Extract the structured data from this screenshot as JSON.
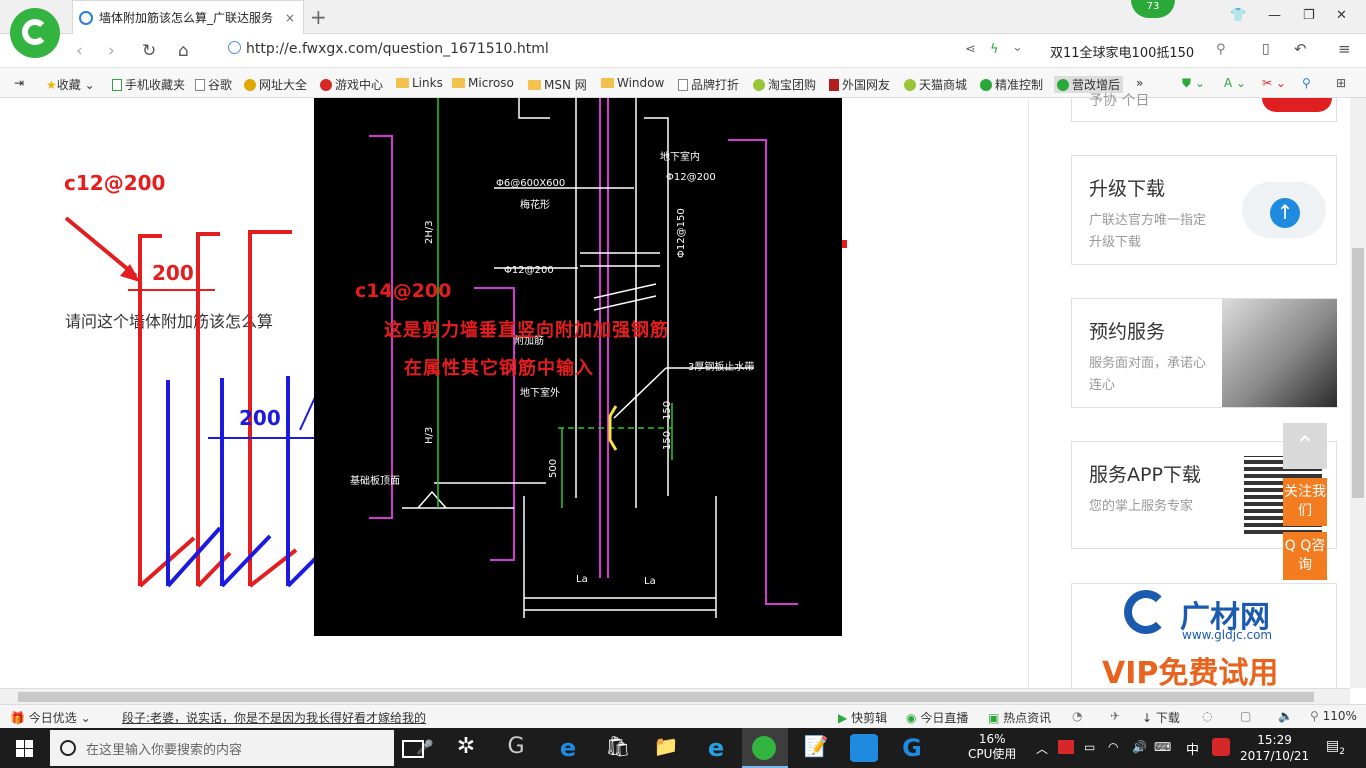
{
  "browser": {
    "tab_title": "墙体附加筋该怎么算_广联达服务",
    "tab_close": "×",
    "new_tab": "+",
    "badge": "73",
    "url": "http://e.fwxgx.com/question_1671510.html",
    "promo": "双11全球家电100抵150"
  },
  "bookmarks": [
    {
      "label": "收藏",
      "icon": "star-icon"
    },
    {
      "label": "手机收藏夹",
      "icon": "phone-icon"
    },
    {
      "label": "谷歌",
      "icon": "doc-icon"
    },
    {
      "label": "网址大全",
      "icon": "site-icon"
    },
    {
      "label": "游戏中心",
      "icon": "game-icon"
    },
    {
      "label": "Links",
      "icon": "folder-icon"
    },
    {
      "label": "Microso",
      "icon": "folder-icon"
    },
    {
      "label": "MSN 网",
      "icon": "folder-icon"
    },
    {
      "label": "Window",
      "icon": "folder-icon"
    },
    {
      "label": "品牌打折",
      "icon": "doc-icon"
    },
    {
      "label": "淘宝团购",
      "icon": "leaf-icon"
    },
    {
      "label": "外国网友",
      "icon": "flag-icon"
    },
    {
      "label": "天猫商城",
      "icon": "leaf-icon"
    },
    {
      "label": "精准控制",
      "icon": "wechat-icon"
    },
    {
      "label": "营改增后",
      "icon": "wechat-icon"
    }
  ],
  "article": {
    "question": "请问这个墙体附加筋该怎么算"
  },
  "annotations": {
    "red_spec": "c12@200",
    "red_spacing": "200",
    "blue_spec": "c14@200",
    "blue_spacing": "200",
    "note_line1": "这是剪力墙垂直竖向附加加强钢筋",
    "note_line2": "在属性其它钢筋中输入"
  },
  "cad_labels": {
    "a": "Φ6@600X600",
    "b": "梅花形",
    "c": "地下室内",
    "d": "Φ12@200",
    "e": "Φ12@150",
    "f": "Φ12@200",
    "g": "地下室外",
    "h": "3厚钢板止水带",
    "i": "2H/3",
    "j": "H/3",
    "k": "500",
    "l": "150",
    "m": "150",
    "n": "基础板顶面",
    "o": "La",
    "p": "La",
    "q": "附加筋"
  },
  "sidebar": {
    "top_partial": "予协 个日",
    "cards": [
      {
        "title": "升级下载",
        "desc": "广联达官方唯一指定升级下载",
        "icon": "cloud-upload-icon"
      },
      {
        "title": "预约服务",
        "desc": "服务面对面，承诺心连心",
        "icon": "handshake-photo"
      },
      {
        "title": "服务APP下载",
        "desc": "您的掌上服务专家",
        "icon": "qrcode-icon"
      }
    ],
    "ad_brand": "广材网",
    "ad_url": "www.gldjc.com",
    "ad_vip": "VIP免费试用",
    "float_follow": "关注我们",
    "float_qq": "Q Q咨询"
  },
  "statusbar": {
    "today_pick": "今日优选",
    "headline": "段子:老婆，说实话，你是不是因为我长得好看才嫁给我的",
    "quick_cut": "快剪辑",
    "live": "今日直播",
    "hot": "热点资讯",
    "download": "下载",
    "zoom": "110%"
  },
  "taskbar": {
    "search_placeholder": "在这里输入你要搜索的内容",
    "cpu_pct": "16%",
    "cpu_label": "CPU使用",
    "ime": "中",
    "time": "15:29",
    "date": "2017/10/21",
    "notif_count": "2"
  },
  "colors": {
    "annot_red": "#e41e1e",
    "annot_blue": "#1a1ae0",
    "cad_magenta": "#d238d2",
    "cad_green": "#28c828",
    "float_orange": "#f47c20",
    "brand_green": "#33b33f"
  }
}
